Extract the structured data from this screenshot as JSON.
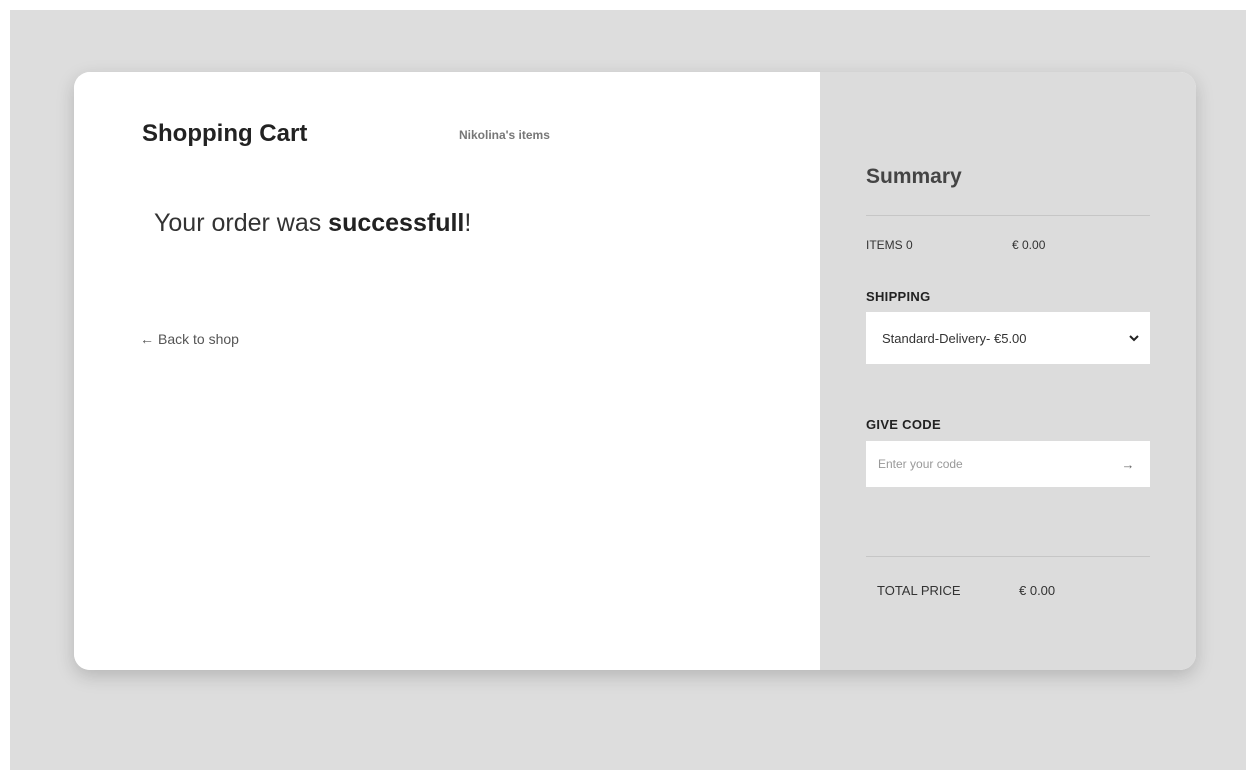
{
  "cart": {
    "title": "Shopping Cart",
    "subtitle": "Nikolina's items",
    "message_prefix": "Your order was ",
    "message_bold": "successfull",
    "message_suffix": "!",
    "back_arrow": "←",
    "back_label": "Back to shop"
  },
  "summary": {
    "title": "Summary",
    "items_label": "ITEMS 0",
    "items_price": "€ 0.00",
    "shipping_label": "SHIPPING",
    "shipping_selected": "Standard-Delivery- €5.00",
    "code_label": "GIVE CODE",
    "code_placeholder": "Enter your code",
    "code_arrow": "→",
    "total_label": "TOTAL PRICE",
    "total_price": "€ 0.00"
  },
  "colors": {
    "page_background": "#dddddd",
    "card_background": "#ffffff",
    "summary_background": "#dcdcdc"
  },
  "icons": {
    "back": "arrow-left-icon",
    "dropdown": "chevron-down-icon",
    "submit": "arrow-right-icon"
  }
}
